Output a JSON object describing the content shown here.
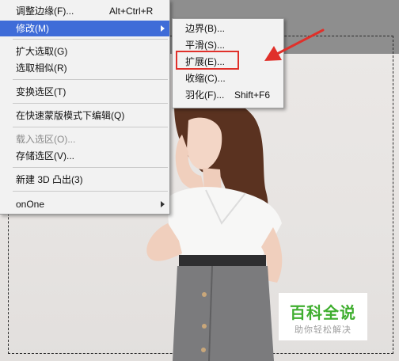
{
  "main_menu": {
    "items": [
      {
        "label": "调整边缘(F)...",
        "shortcut": "Alt+Ctrl+R"
      },
      {
        "label": "修改(M)",
        "submenu": true,
        "highlighted": true
      },
      {
        "label": "扩大选取(G)"
      },
      {
        "label": "选取相似(R)"
      },
      {
        "label": "变换选区(T)"
      },
      {
        "label": "在快速蒙版模式下编辑(Q)"
      },
      {
        "label": "载入选区(O)...",
        "disabled": true
      },
      {
        "label": "存储选区(V)..."
      },
      {
        "label": "新建 3D 凸出(3)"
      },
      {
        "label": "onOne",
        "submenu": true
      }
    ]
  },
  "sub_menu": {
    "items": [
      {
        "label": "边界(B)..."
      },
      {
        "label": "平滑(S)..."
      },
      {
        "label": "扩展(E)...",
        "annotated": true
      },
      {
        "label": "收缩(C)..."
      },
      {
        "label": "羽化(F)...",
        "shortcut": "Shift+F6"
      }
    ]
  },
  "watermark": {
    "title": "百科全说",
    "subtitle": "助你轻松解决"
  },
  "colors": {
    "highlight": "#3f6cd8",
    "annotation_red": "#e0302a",
    "watermark_green": "#3fae2f"
  },
  "icons": [
    "submenu-arrow-icon",
    "annotation-arrow-icon"
  ]
}
